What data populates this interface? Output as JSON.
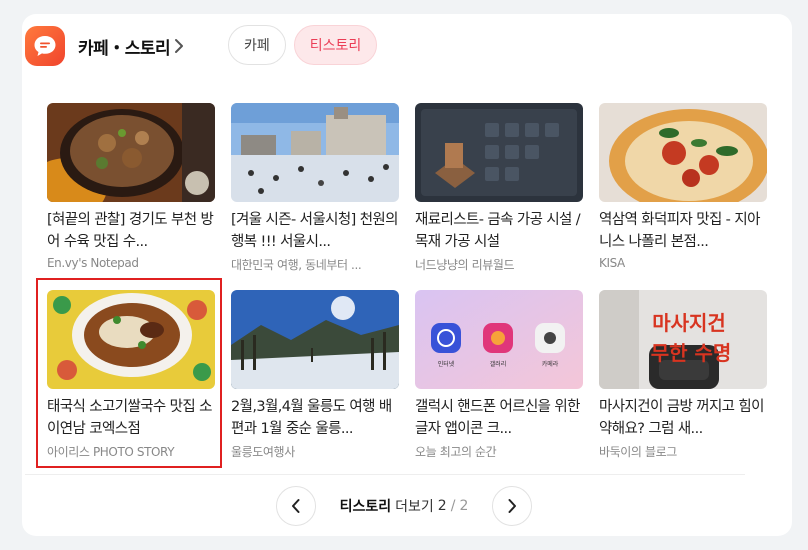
{
  "header": {
    "title": "카페・스토리",
    "tabs": [
      {
        "label": "카페"
      },
      {
        "label": "티스토리"
      }
    ]
  },
  "items": [
    {
      "title": "[혀끝의 관찰] 경기도 부천 방어 수육 맛집 수...",
      "source": "En.vy's Notepad"
    },
    {
      "title": "[겨울 시즌- 서울시청] 천원의 행복 !!! 서울시...",
      "source": "대한민국 여행, 동네부터 ..."
    },
    {
      "title": "재료리스트- 금속 가공 시설 / 목재 가공 시설",
      "source": "너드냥냥의 리뷰월드"
    },
    {
      "title": "역삼역 화덕피자 맛집 - 지아니스 나폴리 본점...",
      "source": "KISA"
    },
    {
      "title": "태국식 소고기쌀국수 맛집 소이연남 코엑스점",
      "source": "아이리스 PHOTO STORY"
    },
    {
      "title": "2월,3월,4월 울릉도 여행 배편과 1월 중순 울릉...",
      "source": "울릉도여행사"
    },
    {
      "title": "갤럭시 핸드폰 어르신을 위한 글자 앱이콘 크...",
      "source": "오늘 최고의 순간"
    },
    {
      "title": "마사지건이 금방 꺼지고 힘이 약해요? 그럼 새...",
      "source": "바둑이의 블로그"
    }
  ],
  "thumb_text": {
    "app1": "인터넷",
    "app2": "갤러리",
    "app3": "카메라",
    "massage_1": "마사지건",
    "massage_2": "무한 수명"
  },
  "pager": {
    "section": "티스토리",
    "more": "더보기",
    "current": "2",
    "slash": "/",
    "total": "2"
  }
}
